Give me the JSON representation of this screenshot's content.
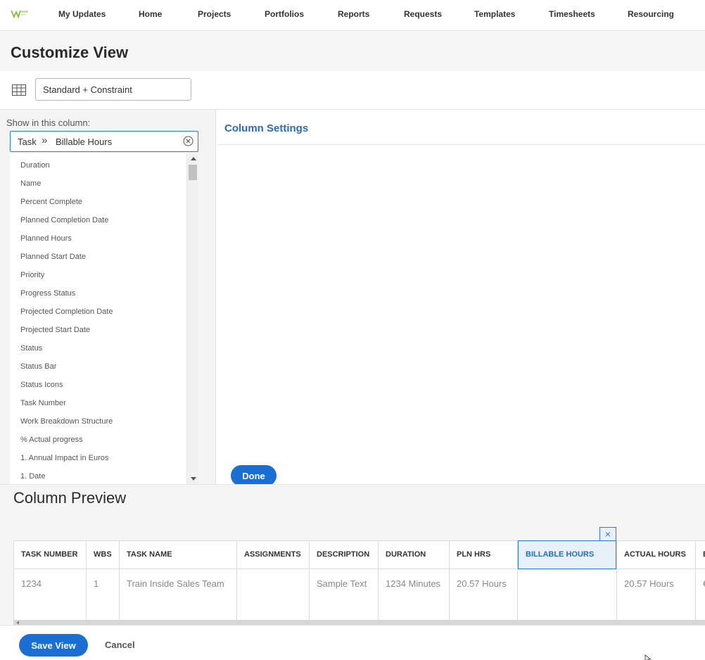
{
  "nav": {
    "logo_alt": "Workfront logo",
    "items": [
      "My Updates",
      "Home",
      "Projects",
      "Portfolios",
      "Reports",
      "Requests",
      "Templates",
      "Timesheets",
      "Resourcing"
    ]
  },
  "page_title": "Customize View",
  "view": {
    "name": "Standard + Constraint"
  },
  "left_panel": {
    "show_label": "Show in this column:",
    "field_object": "Task",
    "field_name": "Billable Hours",
    "fields": [
      "Duration",
      "Name",
      "Percent Complete",
      "Planned Completion Date",
      "Planned Hours",
      "Planned Start Date",
      "Priority",
      "Progress Status",
      "Projected Completion Date",
      "Projected Start Date",
      "Status",
      "Status Bar",
      "Status Icons",
      "Task Number",
      "Work Breakdown Structure",
      "% Actual progress",
      "1. Annual Impact in Euros",
      "1. Date"
    ]
  },
  "right_panel": {
    "title": "Column Settings",
    "done_label": "Done"
  },
  "preview": {
    "title": "Column Preview",
    "close_glyph": "×",
    "columns": [
      {
        "header": "TASK NUMBER",
        "value": "1234"
      },
      {
        "header": "WBS",
        "value": "1"
      },
      {
        "header": "TASK NAME",
        "value": "Train Inside Sales Team"
      },
      {
        "header": "ASSIGNMENTS",
        "value": ""
      },
      {
        "header": "DESCRIPTION",
        "value": "Sample Text"
      },
      {
        "header": "DURATION",
        "value": "1234 Minutes"
      },
      {
        "header": "PLN HRS",
        "value": "20.57 Hours"
      },
      {
        "header": "BILLABLE HOURS",
        "value": ""
      },
      {
        "header": "ACTUAL HOURS",
        "value": "20.57 Hours"
      },
      {
        "header": "B",
        "value": "€"
      }
    ],
    "selected_column_index": 7
  },
  "footer": {
    "save_label": "Save View",
    "cancel_label": "Cancel"
  },
  "colors": {
    "accent": "#1b6ed4",
    "link": "#2b6cb8"
  }
}
